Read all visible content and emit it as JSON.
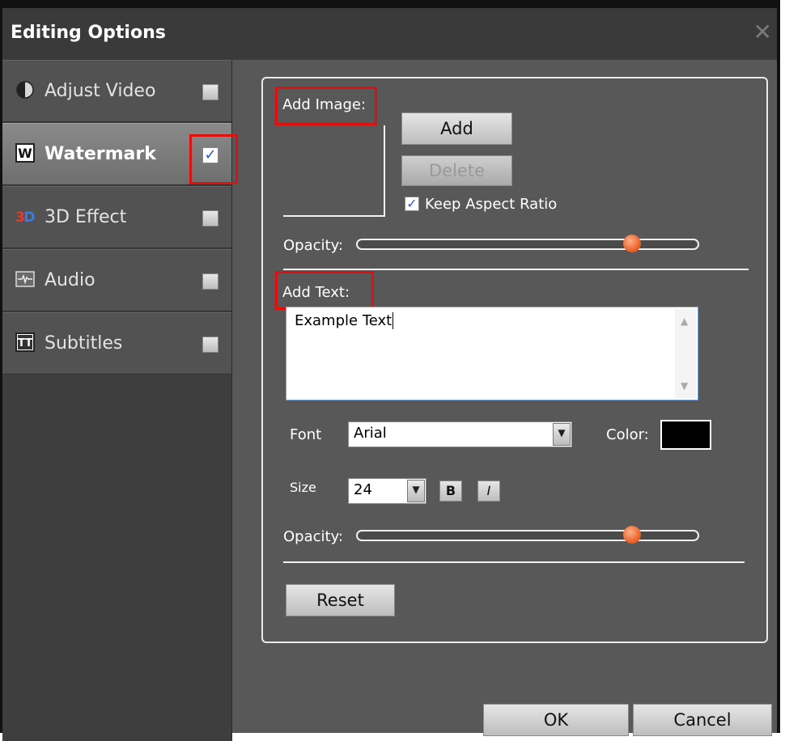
{
  "window": {
    "title": "Editing Options",
    "close_icon": "close-icon"
  },
  "sidebar": {
    "items": [
      {
        "label": "Adjust Video",
        "icon": "adjust-video-icon",
        "checked": false,
        "active": false
      },
      {
        "label": "Watermark",
        "icon": "watermark-icon",
        "checked": true,
        "active": true
      },
      {
        "label": "3D Effect",
        "icon": "3d-effect-icon",
        "checked": false,
        "active": false
      },
      {
        "label": "Audio",
        "icon": "audio-icon",
        "checked": false,
        "active": false
      },
      {
        "label": "Subtitles",
        "icon": "subtitles-icon",
        "checked": false,
        "active": false
      }
    ],
    "check_mark": "✓"
  },
  "image_section": {
    "label": "Add Image:",
    "add_button": "Add",
    "delete_button": "Delete",
    "keep_aspect_label": "Keep Aspect Ratio",
    "keep_aspect_checked": true,
    "opacity_label": "Opacity:",
    "opacity_value": 0.85
  },
  "text_section": {
    "label": "Add Text:",
    "text_value": "Example Text",
    "font_label": "Font",
    "font_value": "Arial",
    "color_label": "Color:",
    "color_value": "#000000",
    "size_label": "Size",
    "size_value": "24",
    "bold_label": "B",
    "italic_label": "I",
    "opacity_label": "Opacity:",
    "opacity_value": 0.85
  },
  "reset_button": "Reset",
  "footer": {
    "ok_button": "OK",
    "cancel_button": "Cancel"
  },
  "colors": {
    "highlight": "#e01010",
    "accent": "#e85a1e",
    "check": "#2a56c8"
  }
}
